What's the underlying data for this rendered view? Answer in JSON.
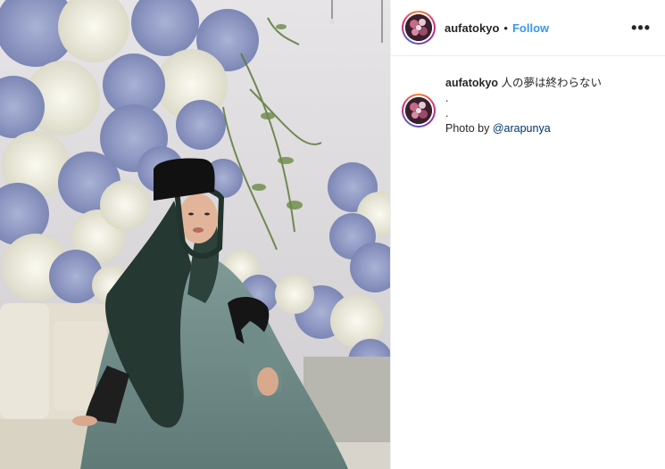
{
  "post": {
    "username": "aufatokyo",
    "separator": "•",
    "follow_label": "Follow",
    "more_icon": "more-options-icon",
    "caption": {
      "username": "aufatokyo",
      "text": "人の夢は終わらない",
      "line2": ".",
      "line3": ".",
      "credit_prefix": "Photo by ",
      "credit_mention": "@arapunya"
    }
  },
  "colors": {
    "follow": "#3897f0",
    "mention": "#003569",
    "text": "#262626",
    "border": "#efefef"
  }
}
